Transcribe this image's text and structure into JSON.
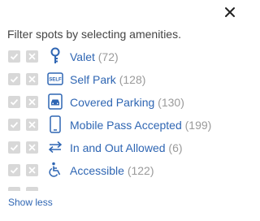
{
  "panel": {
    "intro_text": "Filter spots by selecting amenities.",
    "show_less_label": "Show less",
    "colors": {
      "link": "#2f66b3",
      "count": "#9a9a9a",
      "checkbox": "#d8d8d8",
      "text": "#444444"
    }
  },
  "amenities": [
    {
      "name": "Valet",
      "count": "(72)",
      "icon": "key-icon"
    },
    {
      "name": "Self Park",
      "count": "(128)",
      "icon": "self-park-icon"
    },
    {
      "name": "Covered Parking",
      "count": "(130)",
      "icon": "covered-parking-icon"
    },
    {
      "name": "Mobile Pass Accepted",
      "count": "(199)",
      "icon": "mobile-phone-icon"
    },
    {
      "name": "In and Out Allowed",
      "count": "(6)",
      "icon": "in-out-arrows-icon"
    },
    {
      "name": "Accessible",
      "count": "(122)",
      "icon": "wheelchair-icon"
    }
  ]
}
